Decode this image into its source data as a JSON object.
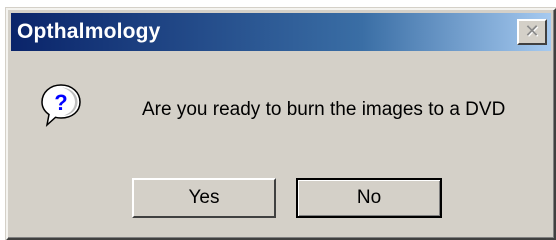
{
  "dialog": {
    "title": "Opthalmology",
    "close_glyph": "✕",
    "icon": "question-icon",
    "message": "Are you ready to burn the images to a DVD",
    "buttons": {
      "yes_label": "Yes",
      "no_label": "No"
    }
  },
  "colors": {
    "title_gradient_start": "#0a246a",
    "title_gradient_end": "#a6caf0",
    "dialog_face": "#d4d0c8",
    "icon_blue": "#0000ff"
  }
}
